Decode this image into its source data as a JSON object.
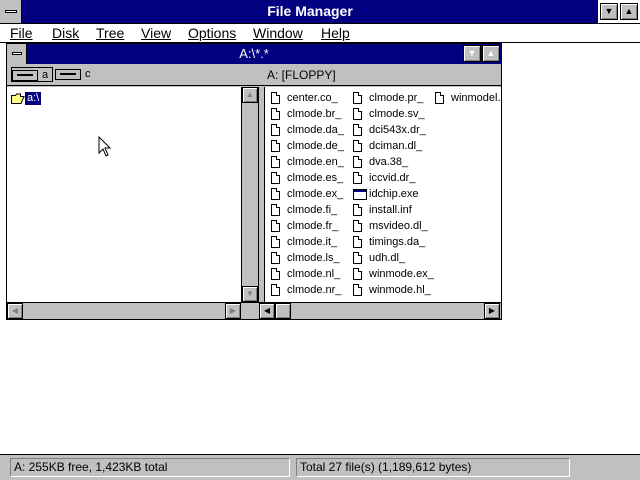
{
  "app": {
    "title": "File Manager",
    "caption_buttons": {
      "minimize": "▼",
      "maximize": "▲"
    }
  },
  "menu": [
    "File",
    "Disk",
    "Tree",
    "View",
    "Options",
    "Window",
    "Help"
  ],
  "child_window": {
    "title": "A:\\*.*",
    "maximize_glyph": "▲",
    "drives": [
      {
        "letter": "a",
        "selected": true
      },
      {
        "letter": "c",
        "selected": false
      }
    ],
    "volume_label": "A: [FLOPPY]",
    "tree": {
      "root": "a:\\"
    },
    "files": [
      {
        "name": "center.co_",
        "type": "doc"
      },
      {
        "name": "clmode.br_",
        "type": "doc"
      },
      {
        "name": "clmode.da_",
        "type": "doc"
      },
      {
        "name": "clmode.de_",
        "type": "doc"
      },
      {
        "name": "clmode.en_",
        "type": "doc"
      },
      {
        "name": "clmode.es_",
        "type": "doc"
      },
      {
        "name": "clmode.ex_",
        "type": "doc"
      },
      {
        "name": "clmode.fi_",
        "type": "doc"
      },
      {
        "name": "clmode.fr_",
        "type": "doc"
      },
      {
        "name": "clmode.it_",
        "type": "doc"
      },
      {
        "name": "clmode.ls_",
        "type": "doc"
      },
      {
        "name": "clmode.nl_",
        "type": "doc"
      },
      {
        "name": "clmode.nr_",
        "type": "doc"
      },
      {
        "name": "clmode.pr_",
        "type": "doc"
      },
      {
        "name": "clmode.sv_",
        "type": "doc"
      },
      {
        "name": "dci543x.dr_",
        "type": "doc"
      },
      {
        "name": "dciman.dl_",
        "type": "doc"
      },
      {
        "name": "dva.38_",
        "type": "doc"
      },
      {
        "name": "iccvid.dr_",
        "type": "doc"
      },
      {
        "name": "idchip.exe",
        "type": "exe"
      },
      {
        "name": "install.inf",
        "type": "doc"
      },
      {
        "name": "msvideo.dl_",
        "type": "doc"
      },
      {
        "name": "timings.da_",
        "type": "doc"
      },
      {
        "name": "udh.dl_",
        "type": "doc"
      },
      {
        "name": "winmode.ex_",
        "type": "doc"
      },
      {
        "name": "winmode.hl_",
        "type": "doc"
      },
      {
        "name": "winmodel.c",
        "type": "doc"
      }
    ]
  },
  "status": {
    "disk": "A: 255KB free,  1,423KB total",
    "files": "Total 27 file(s) (1,189,612 bytes)"
  },
  "colors": {
    "title_active": "#000080",
    "face": "#c0c0c0",
    "window": "#ffffff"
  }
}
